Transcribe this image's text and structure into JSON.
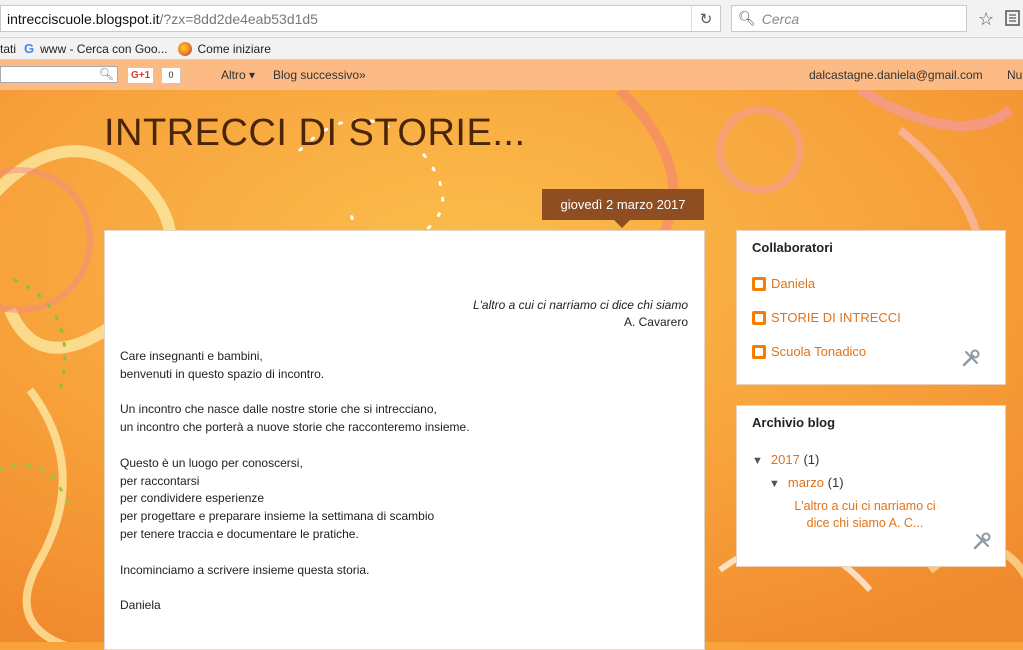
{
  "browser": {
    "url_host": "intrecciscuole.blogspot.it",
    "url_rest": "/?zx=8dd2de4eab53d1d5",
    "search_placeholder": "Cerca",
    "bookmarks": [
      {
        "label": "tati"
      },
      {
        "label": "www - Cerca con Goo..."
      },
      {
        "label": "Come iniziare"
      }
    ]
  },
  "navbar": {
    "gplus_label": "G+1",
    "gplus_count": "0",
    "altro": "Altro ▾",
    "next_blog": "Blog successivo»",
    "email": "dalcastagne.daniela@gmail.com",
    "new": "Nu"
  },
  "blog": {
    "title": "INTRECCI DI STORIE...",
    "date_header": "giovedì 2 marzo 2017"
  },
  "post": {
    "quote_line1": "L'altro a cui ci narriamo ci dice chi siamo",
    "quote_line2": "A. Cavarero",
    "paragraphs": [
      [
        "Care insegnanti e bambini,",
        "benvenuti in questo spazio di incontro."
      ],
      [
        "Un incontro che nasce dalle nostre storie che si intrecciano,",
        "un incontro che porterà a nuove storie che racconteremo insieme."
      ],
      [
        "Questo è un luogo per conoscersi,",
        "per raccontarsi",
        "per condividere esperienze",
        "per progettare e preparare insieme la settimana di scambio",
        "per tenere traccia e documentare le pratiche."
      ],
      [
        "Incominciamo a scrivere insieme questa storia."
      ],
      [
        "Daniela"
      ]
    ]
  },
  "sidebar": {
    "collaboratori": {
      "title": "Collaboratori",
      "items": [
        {
          "label": "Daniela"
        },
        {
          "label": "STORIE DI INTRECCI"
        },
        {
          "label": "Scuola Tonadico"
        }
      ]
    },
    "archivio": {
      "title": "Archivio blog",
      "year": "2017",
      "year_count": "(1)",
      "month": "marzo",
      "month_count": "(1)",
      "post_title": "L'altro a cui ci narriamo ci dice chi siamo A. C..."
    }
  },
  "colors": {
    "background": "#f7a33a",
    "link": "#e0731a",
    "date_header_bg": "#8e4e22",
    "title_color": "#4a2508"
  }
}
